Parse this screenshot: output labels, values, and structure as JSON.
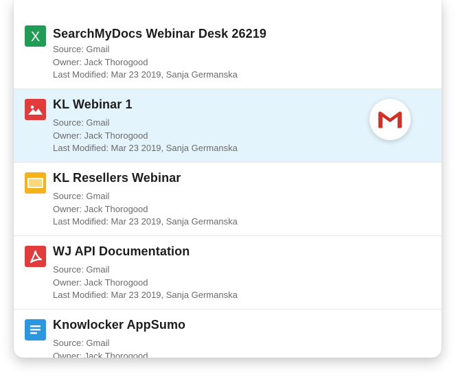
{
  "documents": [
    {
      "title": "SearchMyDocs Webinar Desk 26219",
      "icon": "excel-icon",
      "icon_color": "#1f9d55",
      "source": "Source: Gmail",
      "owner": "Owner: Jack Thorogood",
      "modified": "Last Modified: Mar 23 2019, Sanja Germanska",
      "selected": false
    },
    {
      "title": "KL Webinar 1",
      "icon": "image-icon",
      "icon_color": "#e23b3b",
      "source": "Source: Gmail",
      "owner": "Owner: Jack Thorogood",
      "modified": "Last Modified: Mar 23 2019, Sanja Germanska",
      "selected": true
    },
    {
      "title": "KL Resellers Webinar",
      "icon": "slides-icon",
      "icon_color": "#f5b21a",
      "source": "Source: Gmail",
      "owner": "Owner: Jack Thorogood",
      "modified": "Last Modified: Mar 23 2019, Sanja Germanska",
      "selected": false
    },
    {
      "title": "WJ API Documentation",
      "icon": "pdf-icon",
      "icon_color": "#e23b3b",
      "source": "Source: Gmail",
      "owner": "Owner: Jack Thorogood",
      "modified": "Last Modified: Mar 23 2019, Sanja Germanska",
      "selected": false
    },
    {
      "title": "Knowlocker AppSumo",
      "icon": "doc-icon",
      "icon_color": "#2b97e0",
      "source": "Source: Gmail",
      "owner": "Owner: Jack Thorogood",
      "modified": "",
      "selected": false
    }
  ],
  "badge": {
    "icon": "gmail-icon",
    "colors": {
      "red": "#d93025",
      "light_red": "#ea4335"
    }
  },
  "colors": {
    "selected_bg": "#e4f4fc",
    "divider": "#e6e6e6",
    "title_text": "#1d1d1d",
    "meta_text": "#6b6b6b"
  }
}
